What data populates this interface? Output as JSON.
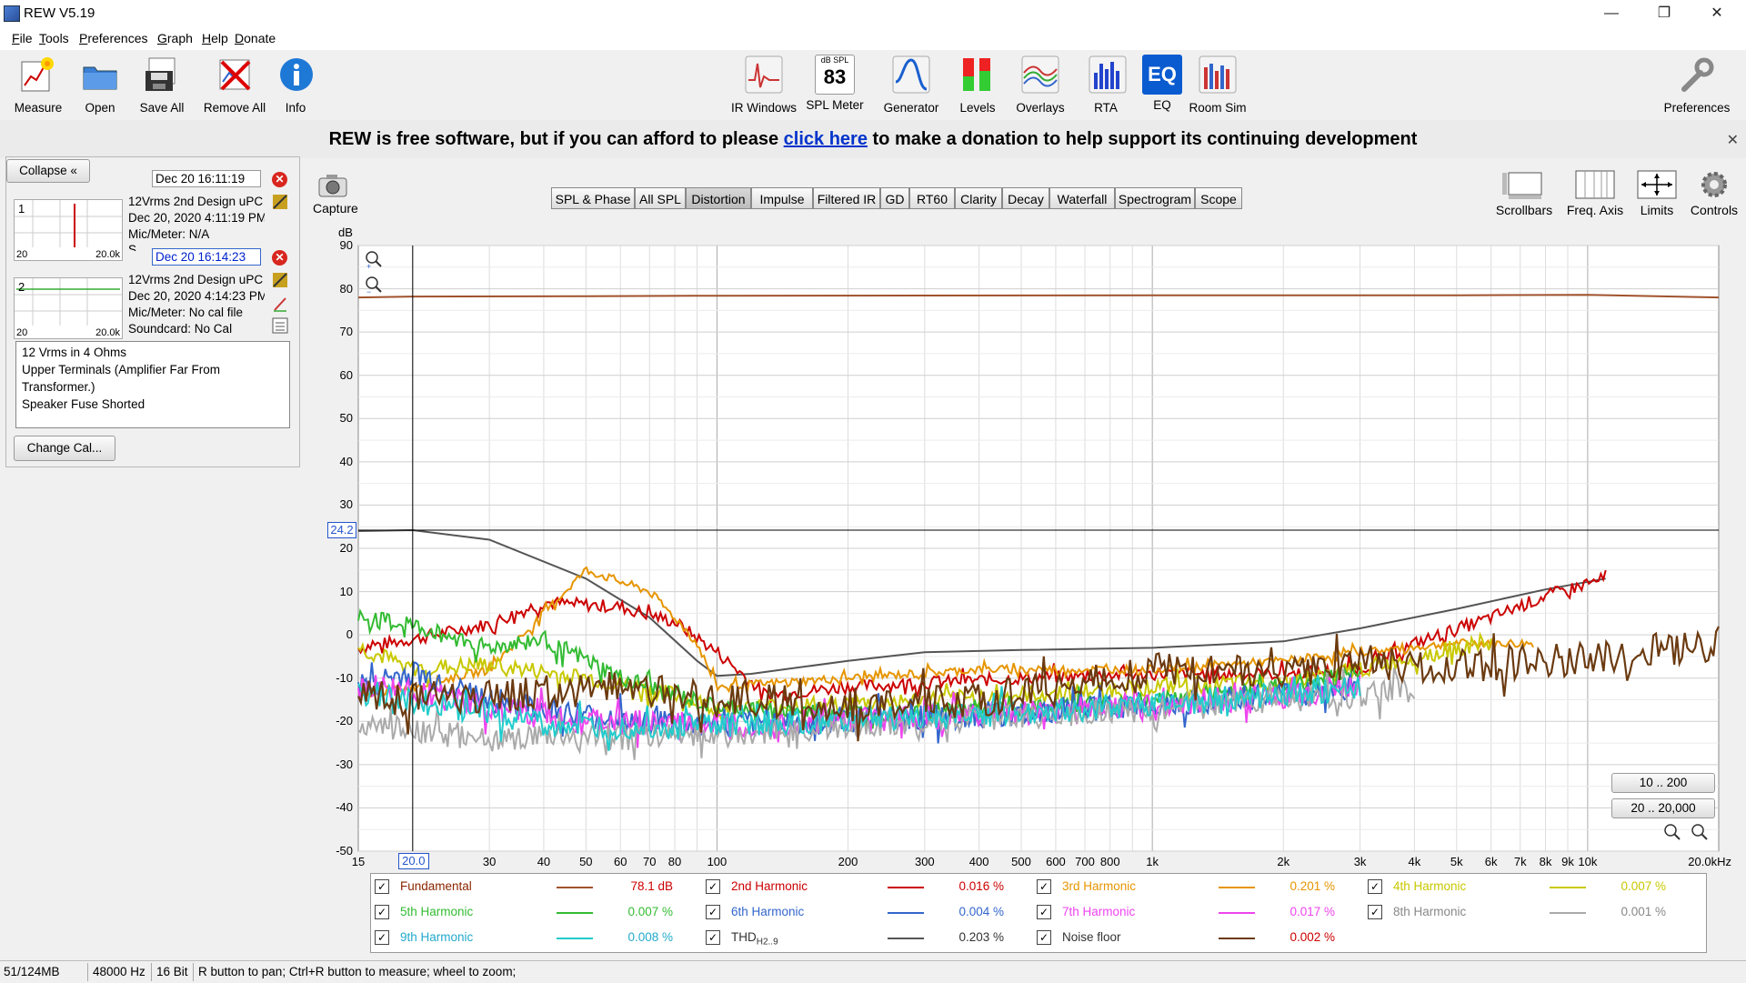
{
  "window": {
    "title": "REW V5.19",
    "minimize": "—",
    "maximize": "❐",
    "close": "✕"
  },
  "menu": [
    {
      "label": "File",
      "u": "F",
      "rest": "ile"
    },
    {
      "label": "Tools",
      "u": "T",
      "rest": "ools"
    },
    {
      "label": "Preferences",
      "u": "P",
      "rest": "references"
    },
    {
      "label": "Graph",
      "u": "G",
      "rest": "raph"
    },
    {
      "label": "Help",
      "u": "H",
      "rest": "elp"
    },
    {
      "label": "Donate",
      "u": "D",
      "rest": "onate"
    }
  ],
  "toolbar": {
    "measure": "Measure",
    "open": "Open",
    "save_all": "Save All",
    "remove_all": "Remove All",
    "info": "Info",
    "ir_windows": "IR Windows",
    "spl_meter": "SPL Meter",
    "spl_top": "dB SPL",
    "spl_value": "83",
    "generator": "Generator",
    "levels": "Levels",
    "overlays": "Overlays",
    "rta": "RTA",
    "eq": "EQ",
    "eq_icon": "EQ",
    "room_sim": "Room Sim",
    "preferences": "Preferences"
  },
  "banner": {
    "pre": "REW is free software, but if you can afford to please",
    "link": "click here",
    "post": "to make a donation to help support its continuing development",
    "close": "✕"
  },
  "left_panel": {
    "collapse": "Collapse",
    "measurements": [
      {
        "num": "1",
        "date": "Dec 20 16:11:19",
        "name": "12Vrms 2nd Design uPC",
        "time": "Dec 20, 2020 4:11:19 PM",
        "mic": "Mic/Meter: N/A",
        "sound": "S",
        "thumb_lo": "20",
        "thumb_hi": "20.0k"
      },
      {
        "num": "2",
        "date": "Dec 20 16:14:23",
        "name": "12Vrms 2nd Design uPC",
        "time": "Dec 20, 2020 4:14:23 PM",
        "mic": "Mic/Meter: No cal file",
        "sound": "Soundcard: No Cal",
        "thumb_lo": "20",
        "thumb_hi": "20.0k"
      }
    ],
    "notes": [
      "12 Vrms in 4 Ohms",
      "Upper Terminals (Amplifier Far From",
      "Transformer.)",
      "Speaker Fuse Shorted"
    ],
    "change_cal": "Change Cal..."
  },
  "capture": "Capture",
  "tabs": [
    "SPL & Phase",
    "All SPL",
    "Distortion",
    "Impulse",
    "Filtered IR",
    "GD",
    "RT60",
    "Clarity",
    "Decay",
    "Waterfall",
    "Spectrogram",
    "Scope"
  ],
  "selected_tab": "Distortion",
  "right_tools": {
    "scrollbars": "Scrollbars",
    "freq_axis": "Freq. Axis",
    "limits": "Limits",
    "controls": "Controls"
  },
  "range_buttons": {
    "b1": "10 .. 200",
    "b2": "20 .. 20,000"
  },
  "chart_data": {
    "type": "line",
    "ylabel": "dB",
    "ylim": [
      -50,
      90
    ],
    "xlim": [
      15,
      20000
    ],
    "x_scale": "log",
    "y_ticks": [
      90,
      80,
      70,
      60,
      50,
      40,
      30,
      20,
      10,
      0,
      -10,
      -20,
      -30,
      -40,
      -50
    ],
    "x_ticks": [
      {
        "v": 15,
        "t": "15"
      },
      {
        "v": 30,
        "t": "30"
      },
      {
        "v": 40,
        "t": "40"
      },
      {
        "v": 50,
        "t": "50"
      },
      {
        "v": 60,
        "t": "60"
      },
      {
        "v": 70,
        "t": "70"
      },
      {
        "v": 80,
        "t": "80"
      },
      {
        "v": 100,
        "t": "100"
      },
      {
        "v": 200,
        "t": "200"
      },
      {
        "v": 300,
        "t": "300"
      },
      {
        "v": 400,
        "t": "400"
      },
      {
        "v": 500,
        "t": "500"
      },
      {
        "v": 600,
        "t": "600"
      },
      {
        "v": 700,
        "t": "700"
      },
      {
        "v": 800,
        "t": "800"
      },
      {
        "v": 1000,
        "t": "1k"
      },
      {
        "v": 2000,
        "t": "2k"
      },
      {
        "v": 3000,
        "t": "3k"
      },
      {
        "v": 4000,
        "t": "4k"
      },
      {
        "v": 5000,
        "t": "5k"
      },
      {
        "v": 6000,
        "t": "6k"
      },
      {
        "v": 7000,
        "t": "7k"
      },
      {
        "v": 8000,
        "t": "8k"
      },
      {
        "v": 9000,
        "t": "9k"
      },
      {
        "v": 10000,
        "t": "10k"
      },
      {
        "v": 20000,
        "t": "20.0kHz"
      }
    ],
    "cursor_x": {
      "v": 20,
      "label": "20.0"
    },
    "cursor_y": {
      "v": 24.2,
      "label": "24.2"
    },
    "grid": true,
    "series": [
      {
        "name": "Fundamental",
        "color": "#a0522d",
        "noise": 0,
        "x": [
          15,
          20,
          50,
          100,
          1000,
          5000,
          10000,
          20000
        ],
        "y": [
          78,
          78.2,
          78.3,
          78.4,
          78.5,
          78.5,
          78.6,
          78
        ]
      },
      {
        "name": "THD H2..9",
        "color": "#555555",
        "noise": 0,
        "x": [
          15,
          20,
          30,
          50,
          70,
          90,
          100,
          120,
          200,
          300,
          500,
          1000,
          2000,
          3000,
          5000,
          8000,
          11000
        ],
        "y": [
          24,
          24.2,
          22,
          13,
          4,
          -6,
          -9.5,
          -9,
          -6,
          -4,
          -3.5,
          -3,
          -1.5,
          1.5,
          6,
          10.5,
          13
        ]
      },
      {
        "name": "2nd Harmonic",
        "color": "#cc0000",
        "noise": 1.5,
        "x": [
          15,
          20,
          30,
          40,
          60,
          80,
          100,
          130,
          200,
          500,
          1000,
          2000,
          3000,
          4000,
          6000,
          8000,
          11000
        ],
        "y": [
          -3,
          -1,
          2.5,
          7.5,
          6.5,
          3,
          -4,
          -14,
          -12,
          -10,
          -9,
          -9,
          -8,
          -2,
          4,
          9,
          13
        ]
      },
      {
        "name": "3rd Harmonic",
        "color": "#e69500",
        "noise": 1,
        "x": [
          15,
          20,
          30,
          50,
          70,
          80,
          90,
          100,
          200,
          400,
          1000,
          2000,
          3000,
          5000,
          7500
        ],
        "y": [
          -14,
          -12,
          -8,
          15,
          10,
          4,
          -2,
          -12,
          -10,
          -8,
          -8,
          -6,
          -4,
          -2,
          -2
        ]
      },
      {
        "name": "4th Harmonic",
        "color": "#c8c800",
        "noise": 2,
        "x": [
          15,
          20,
          30,
          50,
          80,
          100,
          200,
          500,
          1000,
          2000,
          3000,
          5000,
          6000
        ],
        "y": [
          -3,
          -8,
          -7,
          -10,
          -14,
          -17,
          -16,
          -14,
          -12,
          -11,
          -8,
          -3,
          -2
        ]
      },
      {
        "name": "5th Harmonic",
        "color": "#33bb33",
        "noise": 2,
        "x": [
          15,
          20,
          30,
          40,
          60,
          80,
          100,
          200,
          500,
          1000,
          2000,
          3000
        ],
        "y": [
          4,
          2,
          -3,
          -1,
          -10,
          -14,
          -17,
          -18,
          -17,
          -15,
          -12,
          -8
        ]
      },
      {
        "name": "6th Harmonic",
        "color": "#3366cc",
        "noise": 3,
        "x": [
          15,
          20,
          30,
          50,
          100,
          200,
          500,
          1000,
          2000,
          3000
        ],
        "y": [
          -12,
          -9,
          -15,
          -19,
          -21,
          -20,
          -18,
          -16,
          -14,
          -12
        ]
      },
      {
        "name": "7th Harmonic",
        "color": "#ee44ee",
        "noise": 3,
        "x": [
          15,
          20,
          30,
          50,
          100,
          200,
          500,
          1000,
          2000,
          3000
        ],
        "y": [
          -12,
          -13,
          -17,
          -20,
          -21,
          -20,
          -18,
          -16,
          -14,
          -12
        ]
      },
      {
        "name": "8th Harmonic",
        "color": "#aaaaaa",
        "noise": 3,
        "x": [
          15,
          20,
          30,
          50,
          100,
          200,
          500,
          1000,
          2000,
          4000
        ],
        "y": [
          -20,
          -22,
          -24,
          -24,
          -23,
          -21,
          -19,
          -17,
          -15,
          -13
        ]
      },
      {
        "name": "9th Harmonic",
        "color": "#22cccc",
        "noise": 3,
        "x": [
          15,
          20,
          30,
          50,
          100,
          200,
          500,
          1000,
          2000,
          3000
        ],
        "y": [
          -13,
          -15,
          -18,
          -22,
          -21,
          -20,
          -18,
          -16,
          -14,
          -12
        ]
      },
      {
        "name": "Noise floor",
        "color": "#6b3a10",
        "noise": 4,
        "x": [
          15,
          20,
          30,
          60,
          100,
          200,
          400,
          700,
          1000,
          2000,
          3000,
          4000,
          5000,
          8000,
          12000,
          20000
        ],
        "y": [
          -14,
          -15,
          -14,
          -12,
          -15,
          -16,
          -15,
          -11,
          -8,
          -8,
          -7,
          -7,
          -7,
          -6,
          -5,
          -2
        ]
      }
    ]
  },
  "legend": [
    {
      "label": "Fundamental",
      "sub": "",
      "color": "#a0522d",
      "value": "78.1 dB",
      "text_color": "#8b2500",
      "value_color": "#cc0000"
    },
    {
      "label": "2nd Harmonic",
      "sub": "",
      "color": "#cc0000",
      "value": "0.016 %",
      "text_color": "#cc0000",
      "value_color": "#cc0000"
    },
    {
      "label": "3rd Harmonic",
      "sub": "",
      "color": "#e69500",
      "value": "0.201 %",
      "text_color": "#e69500",
      "value_color": "#e69500"
    },
    {
      "label": "4th Harmonic",
      "sub": "",
      "color": "#c8c800",
      "value": "0.007 %",
      "text_color": "#c8c800",
      "value_color": "#c8c800"
    },
    {
      "label": "5th Harmonic",
      "sub": "",
      "color": "#33bb33",
      "value": "0.007 %",
      "text_color": "#33bb33",
      "value_color": "#33bb33"
    },
    {
      "label": "6th Harmonic",
      "sub": "",
      "color": "#3366cc",
      "value": "0.004 %",
      "text_color": "#3366cc",
      "value_color": "#3366cc"
    },
    {
      "label": "7th Harmonic",
      "sub": "",
      "color": "#ee44ee",
      "value": "0.017 %",
      "text_color": "#ee44ee",
      "value_color": "#ee44ee"
    },
    {
      "label": "8th Harmonic",
      "sub": "",
      "color": "#aaaaaa",
      "value": "0.001 %",
      "text_color": "#888888",
      "value_color": "#888888"
    },
    {
      "label": "9th Harmonic",
      "sub": "",
      "color": "#22cccc",
      "value": "0.008 %",
      "text_color": "#22aacc",
      "value_color": "#22aacc"
    },
    {
      "label": "THD",
      "sub": "H2..9",
      "color": "#555555",
      "value": "0.203 %",
      "text_color": "#333333",
      "value_color": "#333333"
    },
    {
      "label": "Noise floor",
      "sub": "",
      "color": "#6b3a10",
      "value": "0.002 %",
      "text_color": "#333333",
      "value_color": "#cc0000"
    }
  ],
  "status": {
    "memory": "51/124MB",
    "rate": "48000 Hz",
    "bits": "16 Bit",
    "hint": "R button to pan; Ctrl+R button to measure; wheel to zoom;"
  }
}
